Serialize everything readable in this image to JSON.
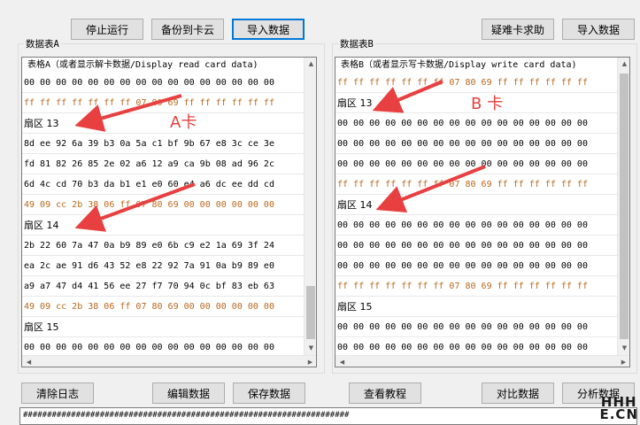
{
  "toolbar": {
    "stop": "停止运行",
    "backup": "备份到卡云",
    "import_left": "导入数据",
    "help": "疑难卡求助",
    "import_right": "导入数据"
  },
  "tableA": {
    "group_label": "数据表A",
    "header": "表格A（或者显示解卡数据/Display read card data)",
    "rows": [
      {
        "text": "00 00 00 00 00 00 00 00 00 00 00 00 00 00 00 00",
        "kind": "data"
      },
      {
        "text": "ff ff ff ff ff ff ff 07 80 69 ff ff ff ff ff ff",
        "kind": "trailer"
      },
      {
        "text": "扇区 13",
        "kind": "sector"
      },
      {
        "text": "8d ee 92 6a 39 b3 0a 5a c1 bf 9b 67 e8 3c ce 3e",
        "kind": "data"
      },
      {
        "text": "fd 81 82 26 85 2e 02 a6 12 a9 ca 9b 08 ad 96 2c",
        "kind": "data"
      },
      {
        "text": "6d 4c cd 70 b3 da b1 e1 e0 60 e4 a6 dc ee dd cd",
        "kind": "data"
      },
      {
        "text": "49 09 cc 2b 38 06 ff 07 80 69 00 00 00 00 00 00",
        "kind": "trailer"
      },
      {
        "text": "扇区 14",
        "kind": "sector"
      },
      {
        "text": "2b 22 60 7a 47 0a b9 89 e0 6b c9 e2 1a 69 3f 24",
        "kind": "data"
      },
      {
        "text": "ea 2c ae 91 d6 43 52 e8 22 92 7a 91 0a b9 89 e0",
        "kind": "data"
      },
      {
        "text": "a9 a7 47 d4 41 56 ee 27 f7 70 94 0c bf 83 eb 63",
        "kind": "data"
      },
      {
        "text": "49 09 cc 2b 38 06 ff 07 80 69 00 00 00 00 00 00",
        "kind": "trailer"
      },
      {
        "text": "扇区 15",
        "kind": "sector"
      },
      {
        "text": "00 00 00 00 00 00 00 00 00 00 00 00 00 00 00 00",
        "kind": "data"
      }
    ],
    "annotation": "A卡"
  },
  "tableB": {
    "group_label": "数据表B",
    "header": "表格B（或者显示写卡数据/Display write card data)",
    "rows": [
      {
        "text": "ff ff ff ff ff ff ff 07 80 69 ff ff ff ff ff ff",
        "kind": "trailer"
      },
      {
        "text": "扇区 13",
        "kind": "sector"
      },
      {
        "text": "00 00 00 00 00 00 00 00 00 00 00 00 00 00 00 00",
        "kind": "data"
      },
      {
        "text": "00 00 00 00 00 00 00 00 00 00 00 00 00 00 00 00",
        "kind": "data"
      },
      {
        "text": "00 00 00 00 00 00 00 00 00 00 00 00 00 00 00 00",
        "kind": "data"
      },
      {
        "text": "ff ff ff ff ff ff ff 07 80 69 ff ff ff ff ff ff",
        "kind": "trailer"
      },
      {
        "text": "扇区 14",
        "kind": "sector"
      },
      {
        "text": "00 00 00 00 00 00 00 00 00 00 00 00 00 00 00 00",
        "kind": "data"
      },
      {
        "text": "00 00 00 00 00 00 00 00 00 00 00 00 00 00 00 00",
        "kind": "data"
      },
      {
        "text": "00 00 00 00 00 00 00 00 00 00 00 00 00 00 00 00",
        "kind": "data"
      },
      {
        "text": "ff ff ff ff ff ff ff 07 80 69 ff ff ff ff ff ff",
        "kind": "trailer"
      },
      {
        "text": "扇区 15",
        "kind": "sector"
      },
      {
        "text": "00 00 00 00 00 00 00 00 00 00 00 00 00 00 00 00",
        "kind": "data"
      },
      {
        "text": "00 00 00 00 00 00 00 00 00 00 00 00 00 00 00 00",
        "kind": "data"
      }
    ],
    "annotation": "B 卡"
  },
  "bottom": {
    "clear_log": "清除日志",
    "edit": "编辑数据",
    "save": "保存数据",
    "tutorial": "查看教程",
    "compare": "对比数据",
    "analyze": "分析数据"
  },
  "log": {
    "text": "####################################################################"
  },
  "watermark": {
    "line1": "HHH",
    "line2": "E.CN"
  },
  "colors": {
    "trailer": "#b8681e",
    "annotation": "#e84040",
    "focus": "#0078d7"
  }
}
